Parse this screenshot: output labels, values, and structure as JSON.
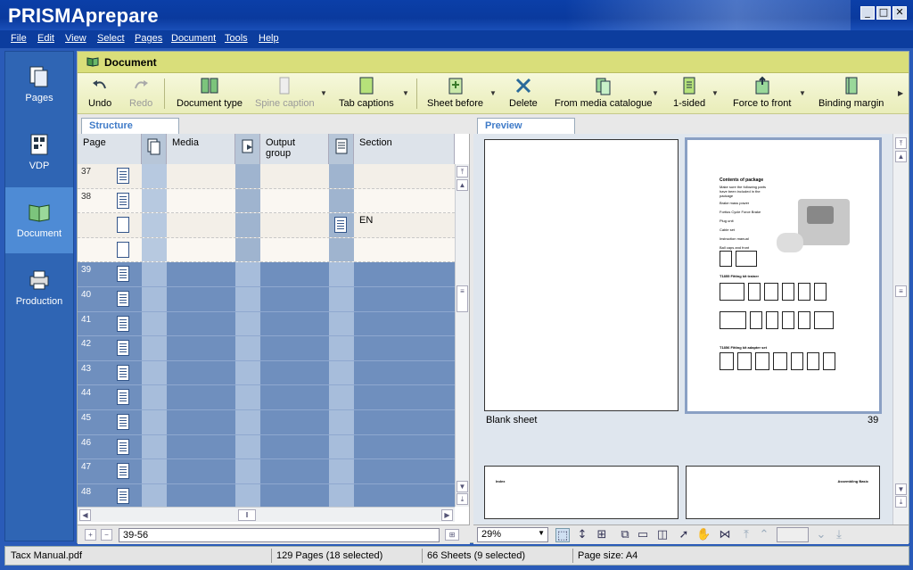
{
  "window": {
    "title": "PRISMAprepare",
    "minimize": "_",
    "maximize": "□",
    "close": "✕"
  },
  "menu": [
    "File",
    "Edit",
    "View",
    "Select",
    "Pages",
    "Document",
    "Tools",
    "Help"
  ],
  "nav": [
    {
      "label": "Pages",
      "icon": "pages-icon",
      "active": false
    },
    {
      "label": "VDP",
      "icon": "vdp-icon",
      "active": false
    },
    {
      "label": "Document",
      "icon": "document-book-icon",
      "active": true
    },
    {
      "label": "Production",
      "icon": "printer-icon",
      "active": false
    }
  ],
  "panel": {
    "title": "Document"
  },
  "toolbar": {
    "undo": "Undo",
    "redo": "Redo",
    "document_type": "Document type",
    "spine_caption": "Spine caption",
    "tab_captions": "Tab captions",
    "sheet_before": "Sheet before",
    "delete": "Delete",
    "from_media_catalogue": "From media catalogue",
    "one_sided": "1-sided",
    "force_to_front": "Force to front",
    "binding_margin": "Binding margin"
  },
  "structure": {
    "tab": "Structure",
    "columns": {
      "page": "Page",
      "media": "Media",
      "output_group": "Output group",
      "section": "Section"
    },
    "rows": [
      {
        "page": "37",
        "selected": false,
        "blank": false
      },
      {
        "page": "38",
        "selected": false,
        "blank": false
      },
      {
        "page": "",
        "selected": false,
        "blank": true,
        "section": "EN"
      },
      {
        "page": "",
        "selected": false,
        "blank": true
      },
      {
        "page": "39",
        "selected": true,
        "blank": false
      },
      {
        "page": "40",
        "selected": true,
        "blank": false
      },
      {
        "page": "41",
        "selected": true,
        "blank": false
      },
      {
        "page": "42",
        "selected": true,
        "blank": false
      },
      {
        "page": "43",
        "selected": true,
        "blank": false
      },
      {
        "page": "44",
        "selected": true,
        "blank": false
      },
      {
        "page": "45",
        "selected": true,
        "blank": false
      },
      {
        "page": "46",
        "selected": true,
        "blank": false
      },
      {
        "page": "47",
        "selected": true,
        "blank": false
      },
      {
        "page": "48",
        "selected": true,
        "blank": false
      }
    ],
    "range": "39-56"
  },
  "preview": {
    "tab": "Preview",
    "left_label": "Blank sheet",
    "right_page": "39",
    "mini": {
      "heading": "Contents of package",
      "intro": "Make sure the following parts have been included in the package",
      "bullets": [
        "Brake mass power",
        "Fortius Cycle Force Brake",
        "Plug unit",
        "Cable set",
        "Instruction manual",
        "Ball caps and front"
      ],
      "section1": "T1855 Fitting kit trainer",
      "section2": "T1856 Fitting kit adapter set",
      "bottom_left": "Index",
      "bottom_right": "Assembling Basic"
    },
    "zoom": "29%"
  },
  "status": {
    "file": "Tacx Manual.pdf",
    "pages": "129 Pages (18 selected)",
    "sheets": "66 Sheets (9 selected)",
    "page_size": "Page size: A4"
  },
  "colors": {
    "titlebar": "#0b3fa8",
    "selection": "#6f8fbe",
    "toolbar_header": "#d9de7a",
    "tab_text": "#3f7bc8"
  }
}
